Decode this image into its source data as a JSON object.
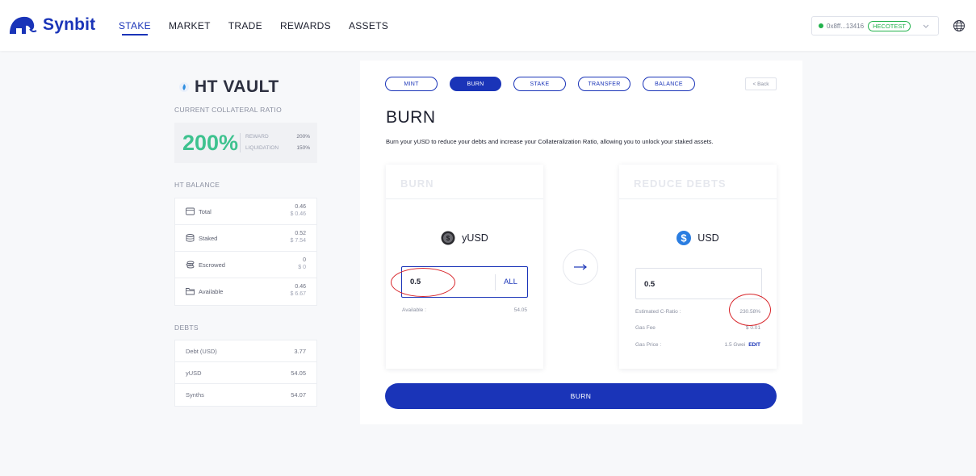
{
  "nav": {
    "brand": "Synbit",
    "links": [
      "STAKE",
      "MARKET",
      "TRADE",
      "REWARDS",
      "ASSETS"
    ],
    "active_link": "STAKE",
    "wallet_address": "0x8ff...13416",
    "network": "HECOTEST",
    "brand_color": "#1a34b8"
  },
  "sidebar": {
    "vault_title": "HT VAULT",
    "collateral_ratio_label": "CURRENT COLLATERAL RATIO",
    "collateral_ratio": "200%",
    "reward_label": "REWARD",
    "reward_value": "200%",
    "liquidation_label": "LIQUIDATION",
    "liquidation_value": "150%",
    "balance_label": "HT BALANCE",
    "balances": [
      {
        "label": "Total",
        "amount": "0.46",
        "usd": "$ 0.46",
        "icon": "wallet-icon"
      },
      {
        "label": "Staked",
        "amount": "0.52",
        "usd": "$ 7.54",
        "icon": "database-icon"
      },
      {
        "label": "Escrowed",
        "amount": "0",
        "usd": "$ 0",
        "icon": "coins-icon"
      },
      {
        "label": "Available",
        "amount": "0.46",
        "usd": "$ 6.67",
        "icon": "folder-icon"
      }
    ],
    "debts_label": "DEBTS",
    "debts": [
      {
        "label": "Debt (USD)",
        "value": "3.77"
      },
      {
        "label": "yUSD",
        "value": "54.05"
      },
      {
        "label": "Synths",
        "value": "54.07"
      }
    ]
  },
  "main": {
    "tabs": [
      {
        "label": "MINT",
        "active": false
      },
      {
        "label": "BURN",
        "active": true
      },
      {
        "label": "STAKE",
        "active": false
      },
      {
        "label": "TRANSFER",
        "active": false
      },
      {
        "label": "BALANCE",
        "active": false
      }
    ],
    "back_label": "< Back",
    "heading": "BURN",
    "description": "Burn your yUSD to reduce your debts and increase your Collateralization Ratio, allowing you to unlock your staked assets.",
    "burn_card": {
      "title": "BURN",
      "token": "yUSD",
      "amount": "0.5",
      "all_label": "ALL",
      "available_label": "Available :",
      "available_value": "54.05"
    },
    "reduce_card": {
      "title": "REDUCE DEBTS",
      "token": "USD",
      "amount": "0.5",
      "c_ratio_label": "Estimated C-Ratio :",
      "c_ratio_value": "230.58%",
      "gas_fee_label": "Gas Fee",
      "gas_fee_value": "$ 0.01",
      "gas_price_label": "Gas Price :",
      "gas_price_value": "1.5 Gwei",
      "edit_label": "EDIT"
    },
    "submit_label": "BURN"
  }
}
